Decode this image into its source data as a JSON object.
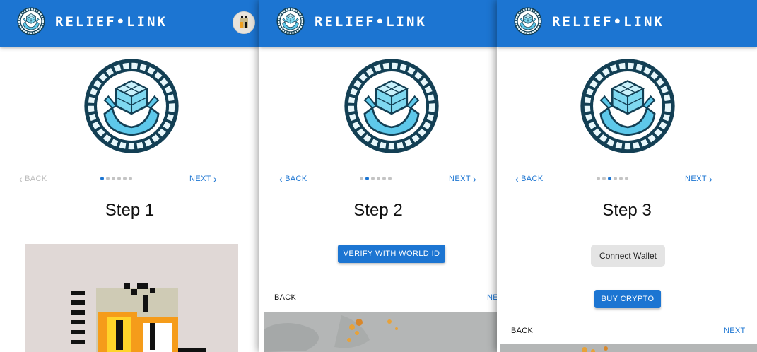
{
  "app": {
    "brand": "RELIEF•LINK",
    "accent": "#1c75d2"
  },
  "icons": [
    "relief-link-logo-icon",
    "avatar-icon",
    "chevron-left-icon",
    "chevron-right-icon"
  ],
  "nav": {
    "back": "BACK",
    "next": "NEXT"
  },
  "steps": [
    {
      "title": "Step 1",
      "active_dot": 1,
      "total_dots": 6,
      "back_enabled": false
    },
    {
      "title": "Step 2",
      "active_dot": 2,
      "total_dots": 6,
      "back_enabled": true,
      "verify_label": "VERIFY WITH WORLD ID",
      "back_label": "BACK",
      "next_label": "NE"
    },
    {
      "title": "Step 3",
      "active_dot": 3,
      "total_dots": 6,
      "back_enabled": true,
      "connect_label": "Connect Wallet",
      "buy_label": "BUY CRYPTO",
      "back_label": "BACK",
      "next_label": "NEXT"
    }
  ]
}
